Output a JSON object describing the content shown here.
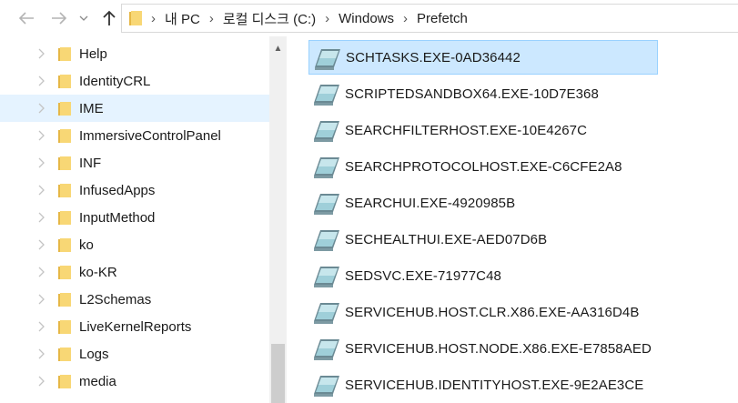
{
  "breadcrumb": [
    "내 PC",
    "로컬 디스크 (C:)",
    "Windows",
    "Prefetch"
  ],
  "tree": {
    "items": [
      "Help",
      "IdentityCRL",
      "IME",
      "ImmersiveControlPanel",
      "INF",
      "InfusedApps",
      "InputMethod",
      "ko",
      "ko-KR",
      "L2Schemas",
      "LiveKernelReports",
      "Logs",
      "media"
    ],
    "selected": "IME"
  },
  "files": {
    "items": [
      "SCHTASKS.EXE-0AD36442",
      "SCRIPTEDSANDBOX64.EXE-10D7E368",
      "SEARCHFILTERHOST.EXE-10E4267C",
      "SEARCHPROTOCOLHOST.EXE-C6CFE2A8",
      "SEARCHUI.EXE-4920985B",
      "SECHEALTHUI.EXE-AED07D6B",
      "SEDSVC.EXE-71977C48",
      "SERVICEHUB.HOST.CLR.X86.EXE-AA316D4B",
      "SERVICEHUB.HOST.NODE.X86.EXE-E7858AED",
      "SERVICEHUB.IDENTITYHOST.EXE-9E2AE3CE"
    ],
    "selected": "SCHTASKS.EXE-0AD36442"
  },
  "colors": {
    "folder": "#f8d775",
    "folder_dark": "#e6b745",
    "selection": "#cce8ff",
    "tree_selection": "#e5f3ff"
  },
  "icons": {
    "back": "arrow-left-icon",
    "forward": "arrow-right-icon",
    "recent": "chevron-down-icon",
    "up": "arrow-up-icon",
    "folder": "folder-icon",
    "file": "prefetch-file-icon"
  }
}
